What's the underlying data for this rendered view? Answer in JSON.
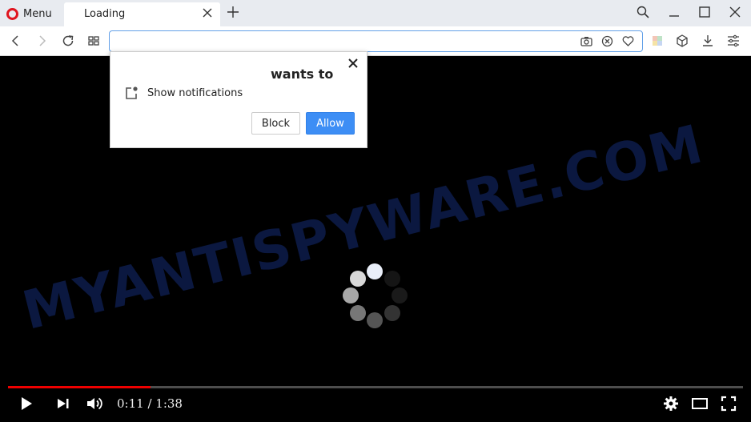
{
  "browser": {
    "menu_label": "Menu",
    "tab_title": "Loading",
    "url_value": "",
    "icons": {
      "menu": "opera-logo-icon",
      "tab_close": "close-icon",
      "new_tab": "plus-icon",
      "search": "search-icon",
      "minimize": "minimize-icon",
      "maximize": "maximize-icon",
      "close_window": "close-icon",
      "back": "chevron-left-icon",
      "forward": "chevron-right-icon",
      "reload": "reload-icon",
      "speed_dial": "grid-icon",
      "snapshot": "camera-icon",
      "block_ads": "block-icon",
      "bookmark": "heart-icon",
      "extension": "cube-icon",
      "download": "download-icon",
      "easy_setup": "settings-sliders-icon"
    }
  },
  "popup": {
    "title": "wants to",
    "permission_label": "Show notifications",
    "block_label": "Block",
    "allow_label": "Allow",
    "allow_color": "#3d8ef5"
  },
  "video": {
    "watermark": "MYANTISPYWARE.COM",
    "current_time": "0:11",
    "duration": "1:38",
    "time_display": "0:11 / 1:38",
    "progress_fraction": 0.1939,
    "progress_color": "#ee0000"
  }
}
